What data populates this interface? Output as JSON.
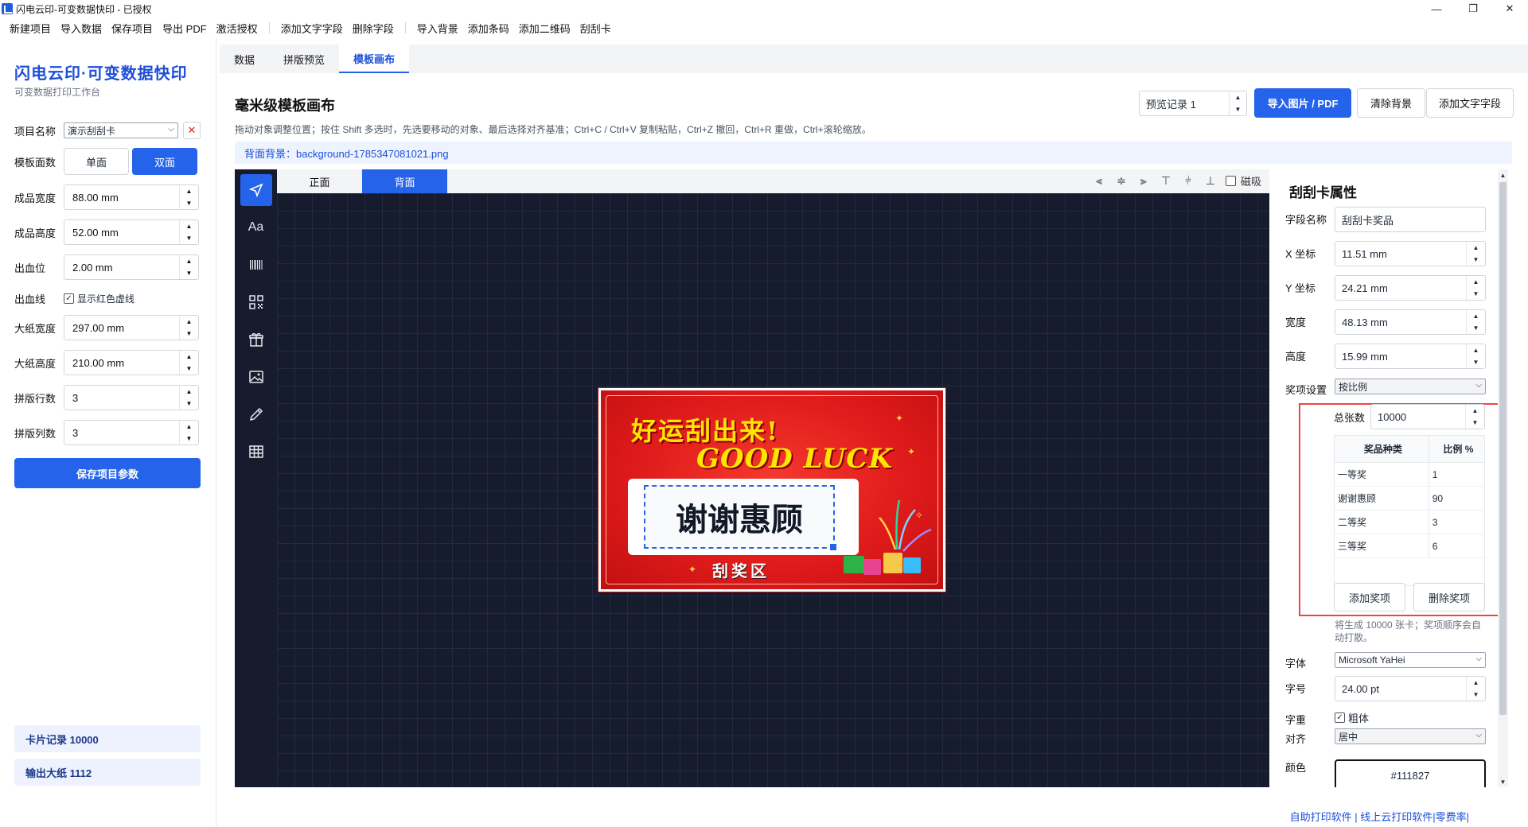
{
  "window": {
    "title": "闪电云印-可变数据快印 - 已授权",
    "controls": {
      "minimize": "—",
      "maximize": "❐",
      "close": "✕"
    }
  },
  "menu": {
    "group1": [
      "新建项目",
      "导入数据",
      "保存项目",
      "导出 PDF",
      "激活授权"
    ],
    "group2": [
      "添加文字字段",
      "删除字段"
    ],
    "group3": [
      "导入背景",
      "添加条码",
      "添加二维码",
      "刮刮卡"
    ]
  },
  "sidebar": {
    "brand": "闪电云印·可变数据快印",
    "brand_sub": "可变数据打印工作台",
    "project_label": "项目名称",
    "project_value": "演示刮刮卡",
    "faces_label": "模板面数",
    "single": "单面",
    "double": "双面",
    "fields": [
      {
        "label": "成品宽度",
        "value": "88.00 mm"
      },
      {
        "label": "成品高度",
        "value": "52.00 mm"
      },
      {
        "label": "出血位",
        "value": "2.00 mm"
      }
    ],
    "bleed_label": "出血线",
    "bleed_check": "显示红色虚线",
    "fields2": [
      {
        "label": "大纸宽度",
        "value": "297.00 mm"
      },
      {
        "label": "大纸高度",
        "value": "210.00 mm"
      },
      {
        "label": "拼版行数",
        "value": "3"
      },
      {
        "label": "拼版列数",
        "value": "3"
      }
    ],
    "save_btn": "保存项目参数",
    "card_records": "卡片记录  10000",
    "output_sheets": "输出大纸  1112"
  },
  "tabs": [
    "数据",
    "拼版预览",
    "模板画布"
  ],
  "main": {
    "title": "毫米级模板画布",
    "hint": "拖动对象调整位置；按住 Shift 多选时，先选要移动的对象、最后选择对齐基准；Ctrl+C / Ctrl+V 复制粘贴，Ctrl+Z 撤回，Ctrl+R 重做，Ctrl+滚轮缩放。",
    "bg_info": "背面背景：background-1785347081021.png",
    "preview_record": "预览记录 1",
    "btn_import": "导入图片 / PDF",
    "btn_clear": "清除背景",
    "btn_add_text": "添加文字字段",
    "face_front": "正面",
    "face_back": "背面",
    "snap": "磁吸"
  },
  "card": {
    "headline": "好运刮出来!",
    "good_luck": "GOOD LUCK",
    "field_text": "谢谢惠顾",
    "zone": "刮奖区"
  },
  "props": {
    "title": "刮刮卡属性",
    "field_name_label": "字段名称",
    "field_name": "刮刮卡奖品",
    "x_label": "X 坐标",
    "x": "11.51 mm",
    "y_label": "Y 坐标",
    "y": "24.21 mm",
    "w_label": "宽度",
    "w": "48.13 mm",
    "h_label": "高度",
    "h": "15.99 mm",
    "prize_setting_label": "奖项设置",
    "prize_setting": "按比例",
    "total_label": "总张数",
    "total": "10000",
    "col_kind": "奖品种类",
    "col_ratio": "比例 %",
    "prizes": [
      {
        "name": "一等奖",
        "ratio": "1"
      },
      {
        "name": "谢谢惠顾",
        "ratio": "90"
      },
      {
        "name": "二等奖",
        "ratio": "3"
      },
      {
        "name": "三等奖",
        "ratio": "6"
      }
    ],
    "add_prize": "添加奖项",
    "del_prize": "删除奖项",
    "note": "将生成 10000 张卡；奖项顺序会自动打散。",
    "font_label": "字体",
    "font": "Microsoft YaHei",
    "size_label": "字号",
    "size": "24.00 pt",
    "weight_label": "字重",
    "bold": "粗体",
    "align_label": "对齐",
    "align": "居中",
    "color_label": "颜色",
    "color": "#111827"
  },
  "footer": "自助打印软件 | 线上云打印软件|零费率|",
  "colors": {
    "accent": "#2563eb",
    "canvas_bg": "#161c2e",
    "card_red": "#e01b1b",
    "highlight": "#ef4444"
  }
}
